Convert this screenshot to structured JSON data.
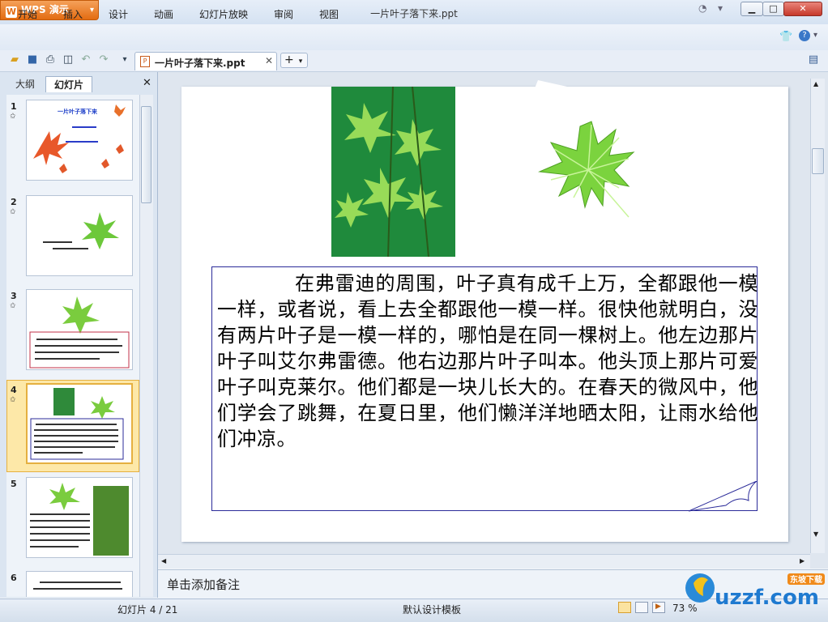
{
  "app": {
    "name": "WPS 演示",
    "window_title": "一片叶子落下来.ppt"
  },
  "menu": [
    "开始",
    "插入",
    "设计",
    "动画",
    "幻灯片放映",
    "审阅",
    "视图"
  ],
  "doc_tab": {
    "label": "一片叶子落下来.ppt"
  },
  "panel": {
    "tab_outline": "大纲",
    "tab_slides": "幻灯片"
  },
  "thumbnails": [
    {
      "num": "1",
      "title": "一片叶子落下来"
    },
    {
      "num": "2",
      "text": "你叫什么名字？"
    },
    {
      "num": "3",
      "text": ""
    },
    {
      "num": "4",
      "text": ""
    },
    {
      "num": "5",
      "text": ""
    },
    {
      "num": "6",
      "text": ""
    }
  ],
  "slide": {
    "body_text": "在弗雷迪的周围，叶子真有成千上万，全都跟他一模一样，或者说，看上去全都跟他一模一样。很快他就明白，没有两片叶子是一模一样的，哪怕是在同一棵树上。他左边那片叶子叫艾尔弗雷德。他右边那片叶子叫本。他头顶上那片可爱叶子叫克莱尔。他们都是一块儿长大的。在春天的微风中，他们学会了跳舞，在夏日里，他们懒洋洋地晒太阳，让雨水给他们冲凉。"
  },
  "notes": {
    "placeholder": "单击添加备注"
  },
  "status": {
    "slide_counter": "幻灯片 4 / 21",
    "template": "默认设计模板",
    "zoom": "73 %"
  },
  "watermark": {
    "text": "uzzf.com",
    "sub": "东坡下载"
  },
  "colors": {
    "wps_orange": "#e36c12",
    "selection": "#e5b040",
    "textbox_border": "#2b2b99"
  }
}
